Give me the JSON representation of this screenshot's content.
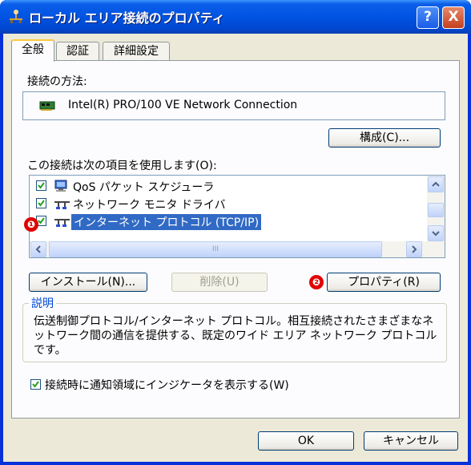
{
  "window": {
    "title": "ローカル エリア接続のプロパティ",
    "help_button": "?",
    "close_button": "X"
  },
  "tabs": [
    {
      "label": "全般",
      "active": true
    },
    {
      "label": "認証",
      "active": false
    },
    {
      "label": "詳細設定",
      "active": false
    }
  ],
  "general": {
    "connect_using_label": "接続の方法:",
    "adapter_name": "Intel(R) PRO/100 VE Network Connection",
    "configure_button": "構成(C)...",
    "items_label": "この接続は次の項目を使用します(O):",
    "items": [
      {
        "label": "QoS パケット スケジューラ",
        "checked": true,
        "icon": "qos-scheduler-icon"
      },
      {
        "label": "ネットワーク モニタ ドライバ",
        "checked": true,
        "icon": "network-protocol-icon"
      },
      {
        "label": "インターネット プロトコル (TCP/IP)",
        "checked": true,
        "icon": "network-protocol-icon",
        "selected": true
      }
    ],
    "scrollbar_grip": "III",
    "install_button": "インストール(N)...",
    "uninstall_button": "削除(U)",
    "properties_button": "プロパティ(R)",
    "description_title": "説明",
    "description_text": "伝送制御プロトコル/インターネット プロトコル。相互接続されたさまざまなネットワーク間の通信を提供する、既定のワイド エリア ネットワーク プロトコルです。",
    "notify_checkbox_label": "接続時に通知領域にインジケータを表示する(W)",
    "notify_checked": true
  },
  "annotations": {
    "marker_1": "❶",
    "marker_2": "❷"
  },
  "footer": {
    "ok_button": "OK",
    "cancel_button": "キャンセル"
  },
  "colors": {
    "title_bar": "#0054e3",
    "selection": "#316ac5",
    "annotation_badge": "#e00000",
    "group_title": "#0046d5"
  }
}
